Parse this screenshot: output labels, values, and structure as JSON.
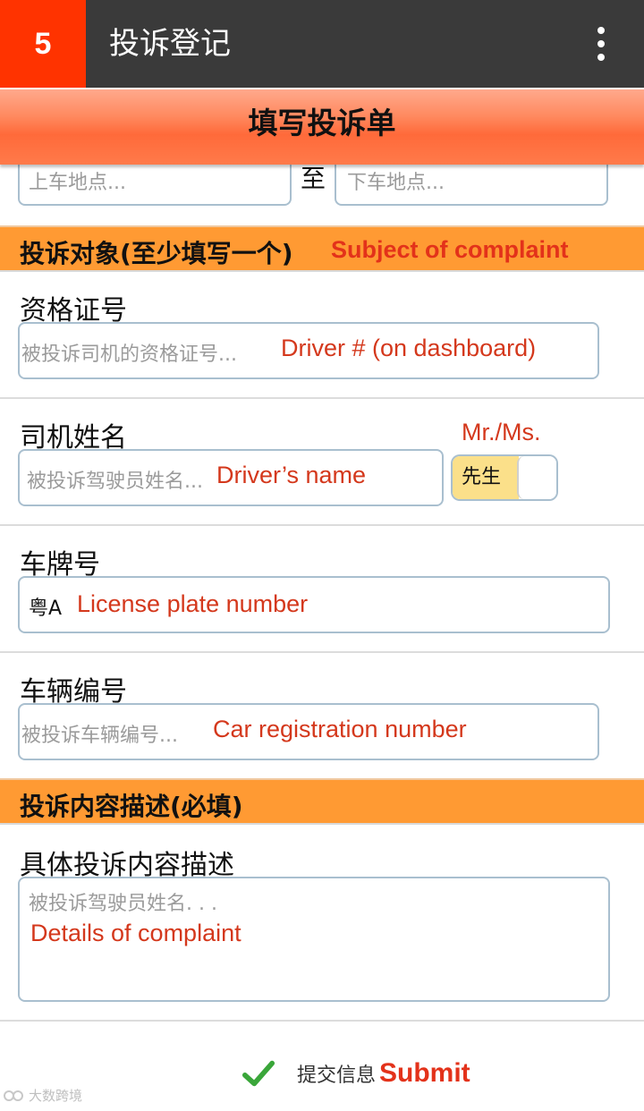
{
  "app_bar": {
    "logo_text": "5",
    "title": "投诉登记",
    "menu_icon": "more-vertical-icon"
  },
  "form_header": "填写投诉单",
  "route": {
    "from_placeholder": "上车地点...",
    "separator": "至",
    "to_placeholder": "下车地点..."
  },
  "section_subject": {
    "zh": "投诉对象(至少填写一个)",
    "en": "Subject of complaint"
  },
  "qualification": {
    "label": "资格证号",
    "placeholder": "被投诉司机的资格证号...",
    "annotation": "Driver # (on dashboard)"
  },
  "driver_name": {
    "label": "司机姓名",
    "title_annotation": "Mr./Ms.",
    "placeholder": "被投诉驾驶员姓名...",
    "annotation": "Driver’s name",
    "toggle_value": "先生"
  },
  "plate": {
    "label": "车牌号",
    "prefix": "粤A",
    "annotation": "License plate number"
  },
  "vehicle_no": {
    "label": "车辆编号",
    "placeholder": "被投诉车辆编号...",
    "annotation": "Car registration number"
  },
  "section_content": {
    "zh": "投诉内容描述(必填)"
  },
  "details": {
    "label": "具体投诉内容描述",
    "placeholder": "被投诉驾驶员姓名. . .",
    "annotation": "Details of complaint"
  },
  "submit": {
    "zh": "提交信息",
    "en": "Submit",
    "icon": "checkmark-icon"
  },
  "watermark": "大数跨境",
  "colors": {
    "logo_bg": "#ff3300",
    "app_bar_bg": "#3a3a3a",
    "section_bg": "#ff9a33",
    "annotation_red": "#d4381c",
    "toggle_on": "#fbe08a",
    "check_green": "#3aa63a"
  }
}
